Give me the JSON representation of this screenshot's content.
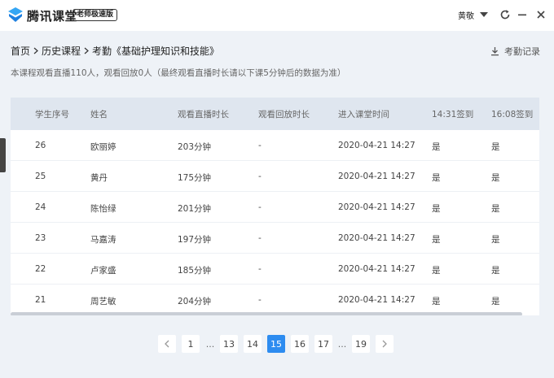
{
  "app": {
    "name": "腾讯课堂",
    "edition": "老师极速版",
    "user": "黄敬",
    "colors": {
      "accent": "#2d8cf0",
      "header_bg": "#dfe6ef",
      "page_bg": "#eef2f7"
    }
  },
  "breadcrumb": [
    "首页",
    "历史课程",
    "考勤《基础护理知识和技能》"
  ],
  "attendance_link": "考勤记录",
  "summary": "本课程观看直播110人，观看回放0人（最终观看直播时长请以下课5分钟后的数据为准）",
  "table": {
    "columns": [
      "学生序号",
      "姓名",
      "观看直播时长",
      "观看回放时长",
      "进入课堂时间",
      "14:31签到",
      "16:08签到"
    ],
    "rows": [
      [
        "26",
        "欧丽婷",
        "203分钟",
        "-",
        "2020-04-21 14:27",
        "是",
        "是"
      ],
      [
        "25",
        "黄丹",
        "175分钟",
        "-",
        "2020-04-21 14:27",
        "是",
        "是"
      ],
      [
        "24",
        "陈怡绿",
        "201分钟",
        "-",
        "2020-04-21 14:27",
        "是",
        "是"
      ],
      [
        "23",
        "马嘉涛",
        "197分钟",
        "-",
        "2020-04-21 14:27",
        "是",
        "是"
      ],
      [
        "22",
        "卢家盛",
        "185分钟",
        "-",
        "2020-04-21 14:27",
        "是",
        "是"
      ],
      [
        "21",
        "周艺敏",
        "204分钟",
        "-",
        "2020-04-21 14:27",
        "是",
        "是"
      ]
    ]
  },
  "pagination": {
    "pages": [
      "1",
      "...",
      "13",
      "14",
      "15",
      "16",
      "17",
      "...",
      "19"
    ],
    "current": "15"
  }
}
